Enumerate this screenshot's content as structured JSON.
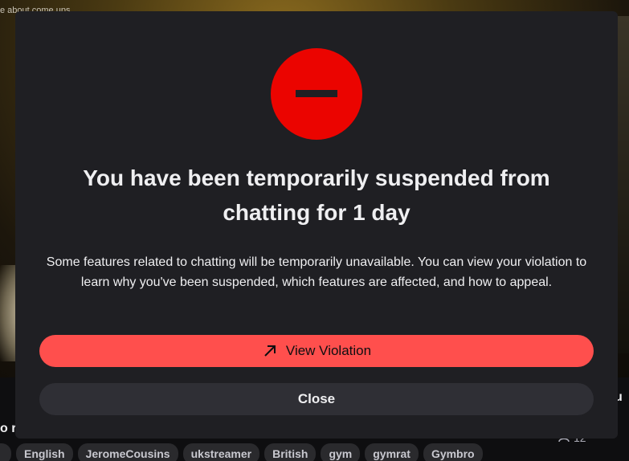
{
  "background": {
    "top_text": "e about come ups",
    "stream_title_fragment": "o r",
    "side_fragment": "u",
    "viewer_fragment": "12",
    "tags": [
      "English",
      "JeromeCousins",
      "ukstreamer",
      "British",
      "gym",
      "gymrat",
      "Gymbro"
    ]
  },
  "modal": {
    "icon": "stop-circle-icon",
    "headline": "You have been temporarily suspended from chatting for 1 day",
    "body": "Some features related to chatting will be temporarily unavailable. You can view your violation to learn why you've been suspended, which features are affected, and how to appeal.",
    "view_violation_label": "View Violation",
    "view_violation_icon": "arrow-up-right-icon",
    "close_label": "Close"
  },
  "colors": {
    "accent_red": "#eb0400",
    "button_red": "#ff4f4d",
    "modal_bg": "#1f1f23",
    "close_bg": "#2f2f35"
  }
}
